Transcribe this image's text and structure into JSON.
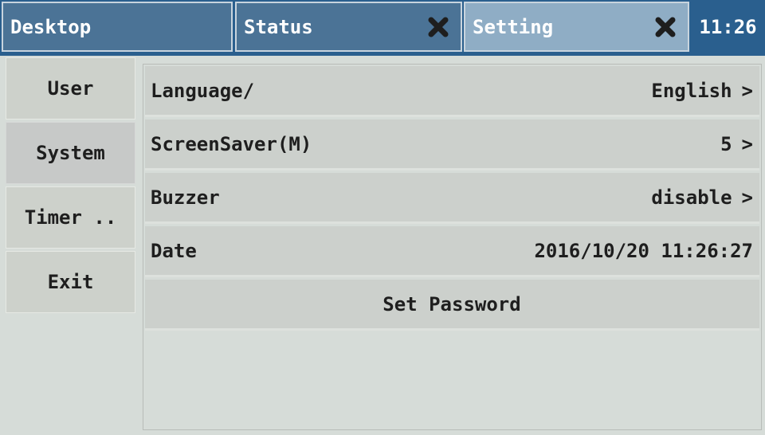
{
  "tabs": {
    "desktop": "Desktop",
    "status": "Status",
    "setting": "Setting",
    "clock": "11:26"
  },
  "sidebar": {
    "items": [
      {
        "label": "User"
      },
      {
        "label": "System"
      },
      {
        "label": "Timer .."
      },
      {
        "label": "Exit"
      }
    ]
  },
  "settings": {
    "rows": [
      {
        "label": "Language/",
        "value": "English",
        "chevron": ">"
      },
      {
        "label": "ScreenSaver(M)",
        "value": "5",
        "chevron": ">"
      },
      {
        "label": "Buzzer",
        "value": "disable",
        "chevron": ">"
      },
      {
        "label": "Date",
        "value": "2016/10/20 11:26:27"
      }
    ],
    "set_password": "Set Password"
  },
  "colors": {
    "tabbar_bg": "#2a5f8e",
    "tab_inactive": "#4b7396",
    "tab_active": "#8fadc5",
    "panel_bg": "#d6dcd8",
    "row_bg": "#ccd0cc"
  },
  "icons": {
    "close": "close-x-icon",
    "chevron": "chevron-right-icon"
  }
}
